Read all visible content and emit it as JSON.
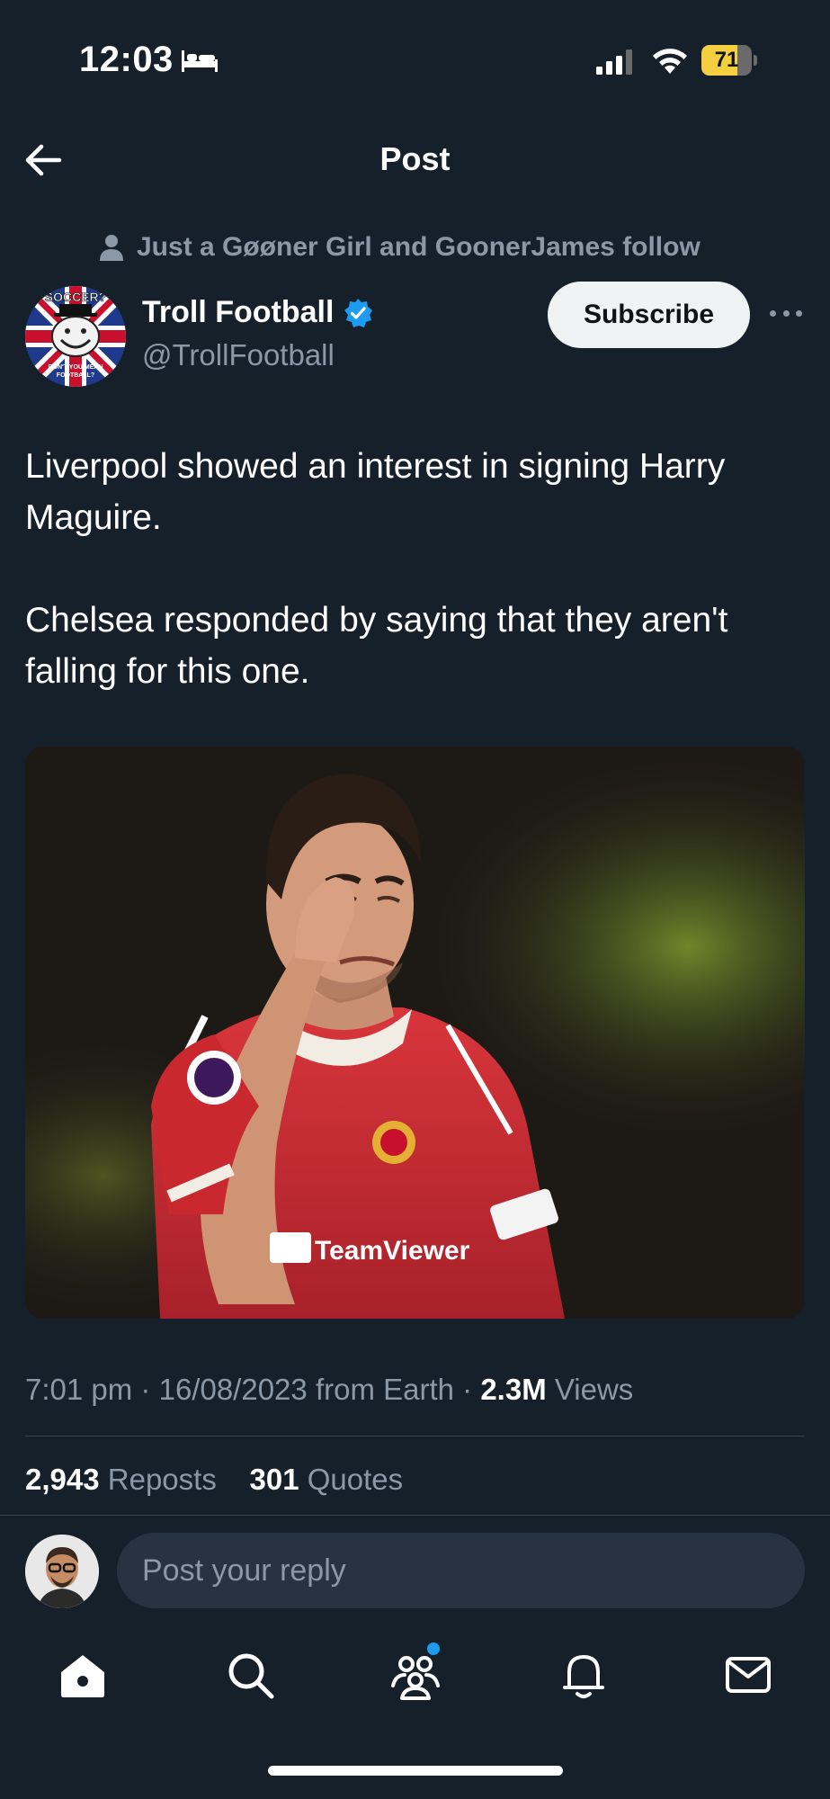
{
  "status_bar": {
    "time": "12:03",
    "battery_level": "71",
    "battery_fraction": 0.71,
    "icons": [
      "bed-icon",
      "signal-icon",
      "wifi-icon",
      "battery-icon"
    ]
  },
  "header": {
    "title": "Post",
    "back_icon": "arrow-left-icon"
  },
  "post": {
    "social_context": "Just a Gøøner Girl and GoonerJames follow",
    "author": {
      "display_name": "Troll Football",
      "handle": "@TrollFootball",
      "verified": true,
      "avatar_text_top": "SOCCER?",
      "avatar_text_bottom": "DON'T YOU MEAN FOOTBALL?"
    },
    "subscribe_label": "Subscribe",
    "text_paragraphs": [
      "Liverpool showed an interest in signing Harry Maguire.",
      "Chelsea responded by saying that they aren't falling for this one."
    ],
    "time": "7:01 pm",
    "date": "16/08/2023",
    "source": "from Earth",
    "views_count": "2.3M",
    "views_label": "Views",
    "reposts_count": "2,943",
    "reposts_label": "Reposts",
    "quotes_count": "301",
    "quotes_label": "Quotes"
  },
  "reply": {
    "placeholder": "Post your reply"
  },
  "tab_bar": {
    "tabs": [
      "home-icon",
      "search-icon",
      "communities-icon",
      "notifications-icon",
      "messages-icon"
    ],
    "accent": "#1d9bf0"
  },
  "colors": {
    "background": "#15202b",
    "secondary_text": "#8b98a5",
    "verified_badge": "#1d9bf0",
    "battery": "#f4d03f"
  }
}
